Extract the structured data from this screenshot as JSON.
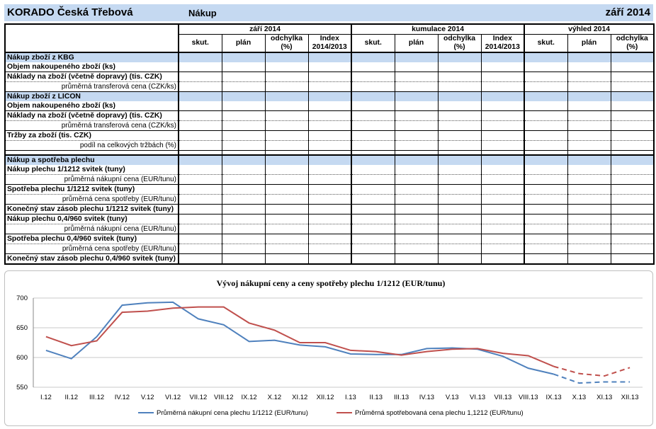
{
  "header": {
    "company": "KORADO Česká Třebová",
    "section": "Nákup",
    "period": "září 2014"
  },
  "table": {
    "groups": [
      "září 2014",
      "kumulace 2014",
      "výhled 2014"
    ],
    "columns": [
      [
        "skut.",
        "plán",
        "odchylka (%)",
        "Index 2014/2013"
      ],
      [
        "skut.",
        "plán",
        "odchylka (%)",
        "Index 2014/2013"
      ],
      [
        "skut.",
        "plán",
        "odchylka (%)"
      ]
    ],
    "rows": [
      {
        "type": "section",
        "text": "Nákup zboží z KBG"
      },
      {
        "type": "main",
        "text": "Objem nakoupeného zboží (ks)"
      },
      {
        "type": "main",
        "text": "Náklady na zboží (včetně dopravy) (tis. CZK)"
      },
      {
        "type": "sub",
        "text": "průměrná transferová cena (CZK/ks)"
      },
      {
        "type": "section",
        "text": "Nákup zboží z LICON"
      },
      {
        "type": "main",
        "text": "Objem nakoupeného zboží (ks)"
      },
      {
        "type": "main",
        "text": "Náklady na zboží (včetně dopravy) (tis. CZK)"
      },
      {
        "type": "sub",
        "text": "průměrná transferová cena (CZK/ks)"
      },
      {
        "type": "main",
        "text": "Tržby za zboží (tis. CZK)"
      },
      {
        "type": "sub",
        "text": "podíl na celkových tržbách (%)"
      },
      {
        "type": "spacer",
        "text": ""
      },
      {
        "type": "section",
        "text": "Nákup a spotřeba plechu"
      },
      {
        "type": "main",
        "text": "Nákup plechu 1/1212 svitek (tuny)"
      },
      {
        "type": "sub",
        "text": "průměrná nákupní cena (EUR/tunu)"
      },
      {
        "type": "main",
        "text": "Spotřeba plechu 1/1212 svitek (tuny)"
      },
      {
        "type": "sub",
        "text": "průměrná cena spotřeby (EUR/tunu)"
      },
      {
        "type": "main",
        "text": "Konečný stav zásob plechu 1/1212 svitek (tuny)"
      },
      {
        "type": "main",
        "text": "Nákup plechu 0,4/960 svitek (tuny)"
      },
      {
        "type": "sub",
        "text": "průměrná nákupní cena (EUR/tunu)"
      },
      {
        "type": "main",
        "text": "Spotřeba plechu 0,4/960 svitek (tuny)"
      },
      {
        "type": "sub",
        "text": "průměrná cena spotřeby (EUR/tunu)"
      },
      {
        "type": "main",
        "text": "Konečný stav zásob plechu 0,4/960 svitek (tuny)"
      }
    ]
  },
  "chart_data": {
    "type": "line",
    "title": "Vývoj nákupní  ceny a ceny spotřeby plechu 1/1212 (EUR/tunu)",
    "categories": [
      "I.12",
      "II.12",
      "III.12",
      "IV.12",
      "V.12",
      "VI.12",
      "VII.12",
      "VIII.12",
      "IX.12",
      "X.12",
      "XI.12",
      "XII.12",
      "I.13",
      "II.13",
      "III.13",
      "IV.13",
      "V.13",
      "VI.13",
      "VII.13",
      "VIII.13",
      "IX.13",
      "X.13",
      "XI.13",
      "XII.13"
    ],
    "ylim": [
      550,
      700
    ],
    "yticks": [
      550,
      600,
      650,
      700
    ],
    "grid": true,
    "legend_position": "bottom",
    "dashed_from_index": 20,
    "series": [
      {
        "name": "Průměrná nákupní cena plechu 1/1212 (EUR/tunu)",
        "color": "#4f81bd",
        "values": [
          612,
          598,
          635,
          688,
          692,
          693,
          665,
          655,
          627,
          629,
          621,
          618,
          606,
          605,
          605,
          615,
          616,
          614,
          602,
          582,
          572,
          557,
          559,
          559
        ]
      },
      {
        "name": "Průměrná spotřebovaná cena plechu 1,1212 (EUR/tunu)",
        "color": "#c0504d",
        "values": [
          635,
          620,
          628,
          676,
          678,
          683,
          685,
          685,
          658,
          646,
          625,
          625,
          612,
          610,
          604,
          610,
          614,
          615,
          607,
          603,
          585,
          573,
          569,
          583
        ]
      }
    ]
  }
}
